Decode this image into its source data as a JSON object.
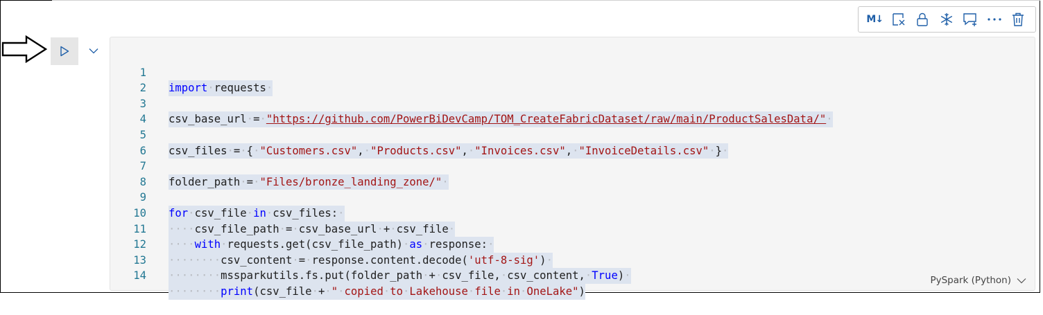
{
  "toolbar": {
    "markdown_label": "M↓",
    "buttons": [
      "toggle-markdown",
      "clear-output",
      "lock",
      "freeze",
      "comment",
      "more",
      "delete"
    ]
  },
  "cell": {
    "language": "PySpark (Python)",
    "lines": [
      {
        "num": "1"
      },
      {
        "num": "2"
      },
      {
        "num": "3"
      },
      {
        "num": "4"
      },
      {
        "num": "5"
      },
      {
        "num": "6"
      },
      {
        "num": "7"
      },
      {
        "num": "8"
      },
      {
        "num": "9"
      },
      {
        "num": "10"
      },
      {
        "num": "11"
      },
      {
        "num": "12"
      },
      {
        "num": "13"
      },
      {
        "num": "14"
      }
    ],
    "code": {
      "l1": {
        "kw": "import",
        "rest": "requests"
      },
      "l3": {
        "var": "csv_base_url",
        "eq": "=",
        "url": "\"https://github.com/PowerBiDevCamp/TOM_CreateFabricDataset/raw/main/ProductSalesData/\""
      },
      "l5": {
        "var": "csv_files",
        "eq": "=",
        "open": "{",
        "s1": "\"Customers.csv\"",
        "s2": "\"Products.csv\"",
        "s3": "\"Invoices.csv\"",
        "s4": "\"InvoiceDetails.csv\"",
        "close": "}"
      },
      "l7": {
        "var": "folder_path",
        "eq": "=",
        "str": "\"Files/bronze_landing_zone/\""
      },
      "l9": {
        "kw1": "for",
        "a": "csv_file",
        "kw2": "in",
        "b": "csv_files:"
      },
      "l10": {
        "text": "csv_file_path = csv_base_url + csv_file"
      },
      "l11": {
        "kw1": "with",
        "a": "requests.get(csv_file_path)",
        "kw2": "as",
        "b": "response:"
      },
      "l12": {
        "a": "csv_content = response.content.decode(",
        "str": "'utf-8-sig'",
        "b": ")"
      },
      "l13": {
        "a": "mssparkutils.fs.put(folder_path + csv_file, csv_content,",
        "kw": "True",
        "b": ")"
      },
      "l14": {
        "kw": "print",
        "a": "(csv_file +",
        "str": "\" copied to Lakehouse file in OneLake\"",
        "b": ")"
      }
    }
  },
  "colors": {
    "keyword": "#0000ff",
    "string": "#a31515",
    "line_number": "#237893",
    "toolbar_icon": "#1f5fa8",
    "cell_background": "#f5f5f5",
    "selection": "#dde4ef"
  }
}
